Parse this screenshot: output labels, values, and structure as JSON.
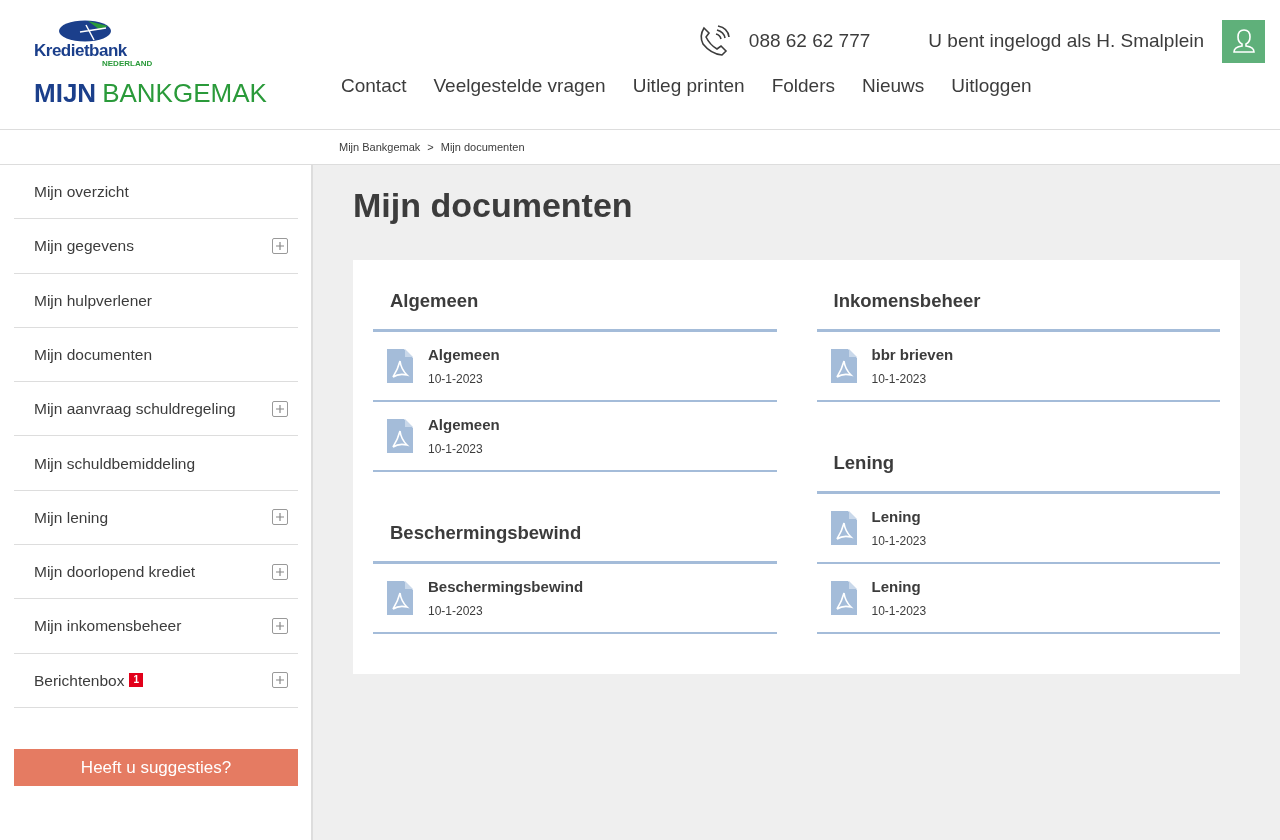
{
  "logo": {
    "name": "Kredietbank",
    "subtitle": "NEDERLAND",
    "product_first": "MIJN",
    "product_second": "BANKGEMAK"
  },
  "header": {
    "phone": "088 62 62 777",
    "user_text": "U bent ingelogd als H. Smalplein"
  },
  "nav": [
    "Contact",
    "Veelgestelde vragen",
    "Uitleg printen",
    "Folders",
    "Nieuws",
    "Uitloggen"
  ],
  "breadcrumb": {
    "items": [
      "Mijn Bankgemak",
      "Mijn documenten"
    ],
    "separator": ">"
  },
  "sidebar": {
    "items": [
      {
        "label": "Mijn overzicht",
        "expandable": false
      },
      {
        "label": "Mijn gegevens",
        "expandable": true
      },
      {
        "label": "Mijn hulpverlener",
        "expandable": false
      },
      {
        "label": "Mijn documenten",
        "expandable": false
      },
      {
        "label": "Mijn aanvraag schuldregeling",
        "expandable": true
      },
      {
        "label": "Mijn schuldbemiddeling",
        "expandable": false
      },
      {
        "label": "Mijn lening",
        "expandable": true
      },
      {
        "label": "Mijn doorlopend krediet",
        "expandable": true
      },
      {
        "label": "Mijn inkomensbeheer",
        "expandable": true
      },
      {
        "label": "Berichtenbox",
        "expandable": true,
        "badge": "1"
      }
    ],
    "suggestion_button": "Heeft u suggesties?"
  },
  "page_title": "Mijn documenten",
  "columns": [
    [
      {
        "title": "Algemeen",
        "documents": [
          {
            "name": "Algemeen",
            "date": "10-1-2023"
          },
          {
            "name": "Algemeen",
            "date": "10-1-2023"
          }
        ]
      },
      {
        "title": "Beschermingsbewind",
        "documents": [
          {
            "name": "Beschermingsbewind",
            "date": "10-1-2023"
          }
        ]
      }
    ],
    [
      {
        "title": "Inkomensbeheer",
        "documents": [
          {
            "name": "bbr brieven",
            "date": "10-1-2023"
          }
        ]
      },
      {
        "title": "Lening",
        "documents": [
          {
            "name": "Lening",
            "date": "10-1-2023"
          },
          {
            "name": "Lening",
            "date": "10-1-2023"
          }
        ]
      }
    ]
  ]
}
